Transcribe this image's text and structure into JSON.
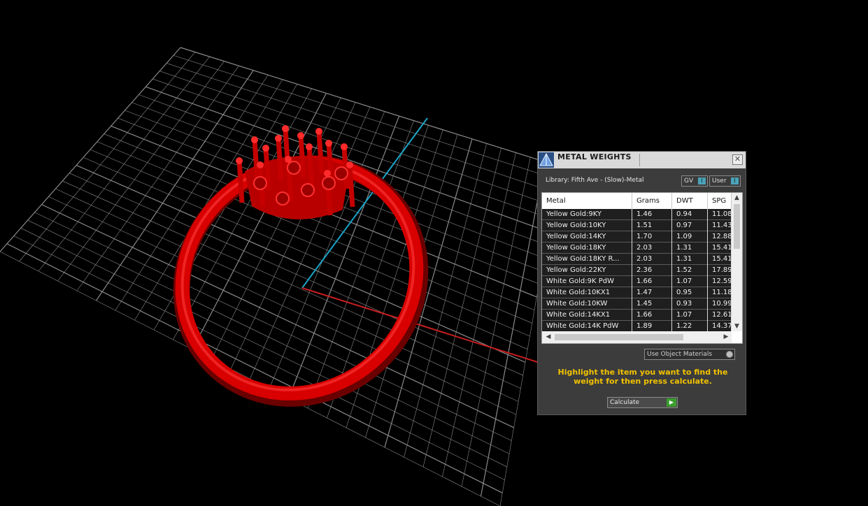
{
  "colors": {
    "grid": "#8a8a8a",
    "axis_y": "#1aa3c8",
    "axis_x": "#c81e1e",
    "ring": "#d80000",
    "accent_text": "#f2c200"
  },
  "viewport": {
    "object": "ring-model"
  },
  "panel": {
    "title": "METAL WEIGHTS",
    "title_icon": "app-logo-icon",
    "close_glyph": "✕",
    "library_label": "Library: Fifth Ave - (Slow)-Metal",
    "toggles": [
      {
        "label": "GV",
        "knob": "I"
      },
      {
        "label": "User",
        "knob": "I"
      }
    ],
    "table": {
      "headers": [
        "Metal",
        "Grams",
        "DWT",
        "SPG"
      ],
      "rows": [
        [
          "Yellow Gold:9KY",
          "1.46",
          "0.94",
          "11.08"
        ],
        [
          "Yellow Gold:10KY",
          "1.51",
          "0.97",
          "11.43"
        ],
        [
          "Yellow Gold:14KY",
          "1.70",
          "1.09",
          "12.88"
        ],
        [
          "Yellow Gold:18KY",
          "2.03",
          "1.31",
          "15.41"
        ],
        [
          "Yellow Gold:18KY R...",
          "2.03",
          "1.31",
          "15.41"
        ],
        [
          "Yellow Gold:22KY",
          "2.36",
          "1.52",
          "17.89"
        ],
        [
          "White Gold:9K PdW",
          "1.66",
          "1.07",
          "12.59"
        ],
        [
          "White Gold:10KX1",
          "1.47",
          "0.95",
          "11.18"
        ],
        [
          "White Gold:10KW",
          "1.45",
          "0.93",
          "10.99"
        ],
        [
          "White Gold:14KX1",
          "1.66",
          "1.07",
          "12.61"
        ],
        [
          "White Gold:14K PdW",
          "1.89",
          "1.22",
          "14.37"
        ]
      ]
    },
    "use_object_materials": "Use Object Materials",
    "instruction": "Highlight the item you want to find the weight for then press calculate.",
    "calculate_label": "Calculate"
  }
}
